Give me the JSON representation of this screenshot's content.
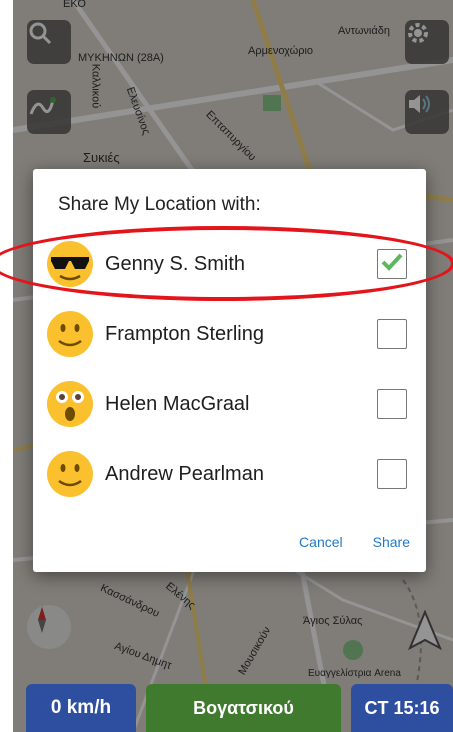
{
  "dialog": {
    "title": "Share My Location with:",
    "contacts": [
      {
        "name": "Genny S. Smith",
        "emoji": "sunglasses-face",
        "checked": true
      },
      {
        "name": "Frampton Sterling",
        "emoji": "smiling-face",
        "checked": false
      },
      {
        "name": "Helen MacGraal",
        "emoji": "surprised-face",
        "checked": false
      },
      {
        "name": "Andrew Pearlman",
        "emoji": "smiling-face",
        "checked": false
      }
    ],
    "cancel_label": "Cancel",
    "share_label": "Share"
  },
  "bottom_bar": {
    "speed": "0 km/h",
    "street": "Βογατσικού",
    "time": "CT 15:16"
  },
  "map_labels": {
    "l1": "ΕΚΟ",
    "l2": "ΜΥΚΗΝΩΝ (28Α)",
    "l3": "Αρμενοχώριο",
    "l4": "Αντωνιάδη",
    "l5": "Συκιές",
    "l6": "Καλλικού",
    "l7": "Ελευσίνος",
    "l8": "Επταπυργίου",
    "l9": "Κασσάνδρου",
    "l10": "Ελένης",
    "l11": "Αγίου Δημητ",
    "l12": "Άγιος Σύλας",
    "l13": "Ευαγγελίστρια Arena",
    "l14": "Μουσικούν"
  },
  "colors": {
    "accent": "#1f7ac7",
    "checkmark": "#5cb85c",
    "highlight_ring": "#e4141b",
    "street_bar": "#3f7a2f",
    "speed_bar": "#2e4fa0"
  }
}
